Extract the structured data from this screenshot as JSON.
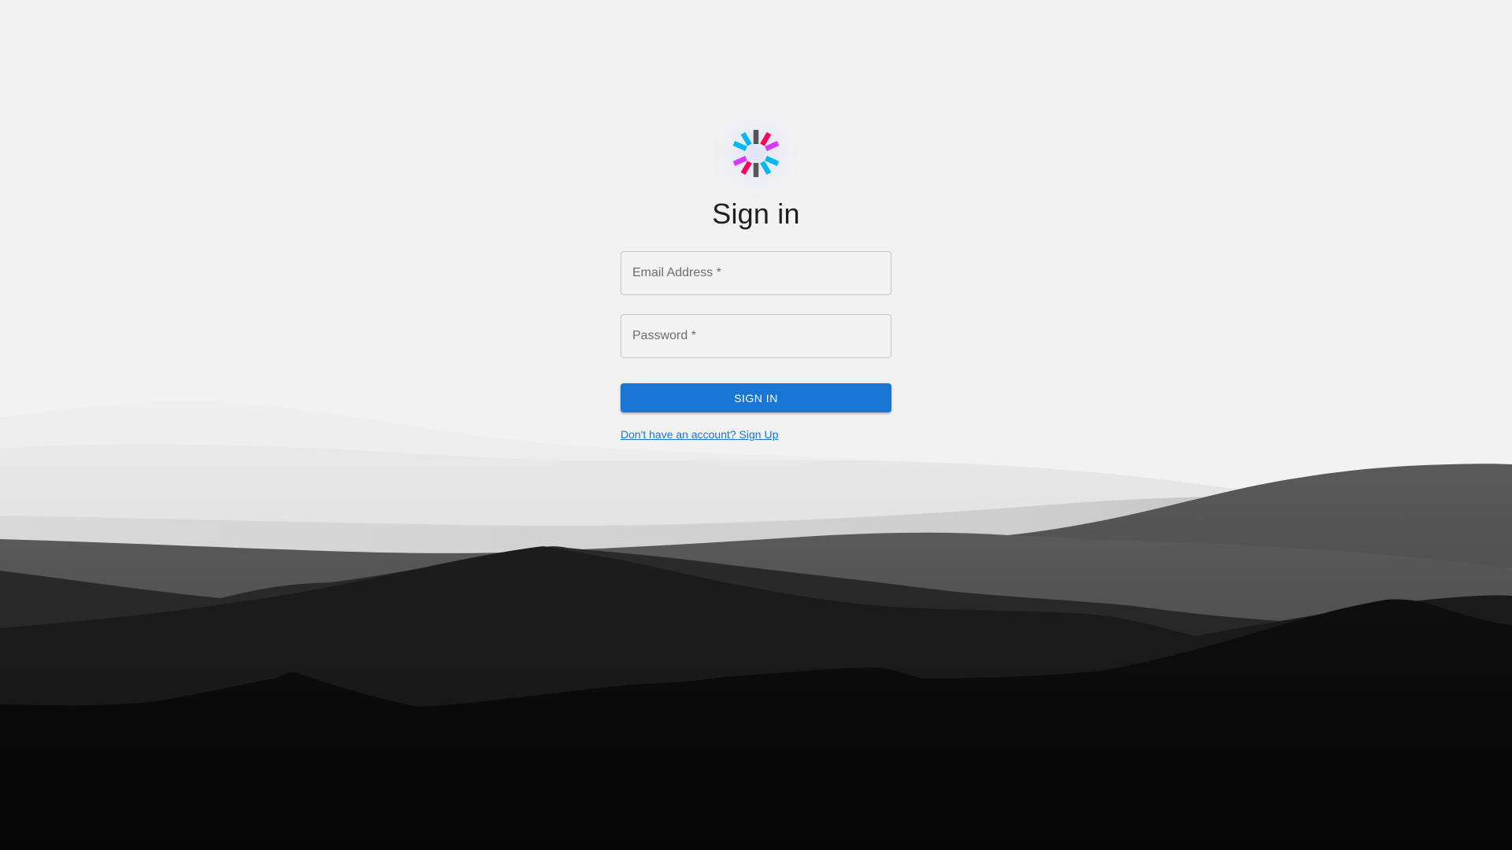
{
  "form": {
    "title": "Sign in",
    "email": {
      "placeholder": "Email Address *",
      "value": ""
    },
    "password": {
      "placeholder": "Password *",
      "value": ""
    },
    "submit_label": "SIGN IN",
    "signup_link_text": "Don't have an account? Sign Up"
  },
  "logo": {
    "icon": "jwt-logo-icon"
  },
  "colors": {
    "background": "#f2f2f2",
    "primary": "#1976d2",
    "logo_cyan": "#00b9f1",
    "logo_magenta": "#d63aff",
    "logo_pink": "#fb015b",
    "logo_gray": "#555555"
  }
}
